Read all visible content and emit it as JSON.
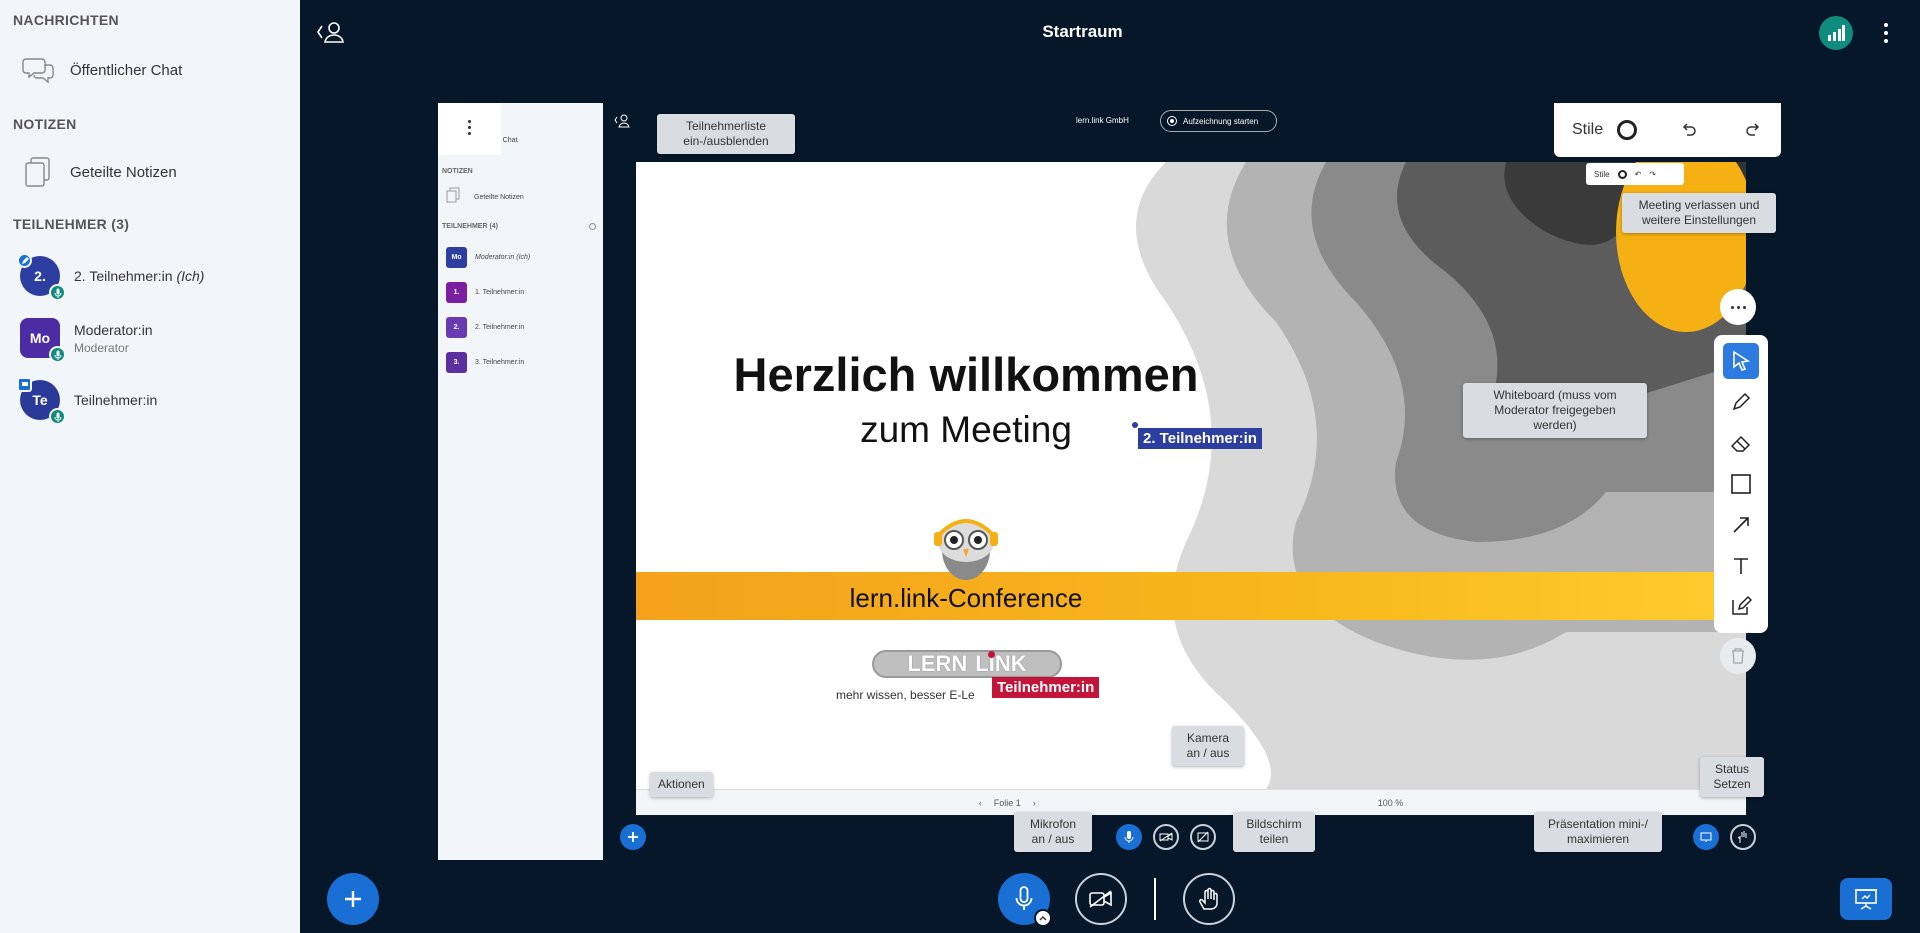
{
  "sidebar": {
    "messages_header": "NACHRICHTEN",
    "public_chat": "Öffentlicher Chat",
    "notes_header": "NOTIZEN",
    "shared_notes": "Geteilte Notizen",
    "participants_header": "TEILNEHMER (3)",
    "users": [
      {
        "initials": "2.",
        "name": "2. Teilnehmer:in",
        "self_tag": "(Ich)",
        "role": "",
        "color": "#2c3e9f"
      },
      {
        "initials": "Mo",
        "name": "Moderator:in",
        "self_tag": "",
        "role": "Moderator",
        "color": "#4b2ca3"
      },
      {
        "initials": "Te",
        "name": "Teilnehmer:in",
        "self_tag": "",
        "role": "",
        "color": "#2b3999"
      }
    ]
  },
  "header": {
    "room_title": "Startraum"
  },
  "mini_sidebar": {
    "chat": "licher Chat",
    "notes_header": "NOTIZEN",
    "notes": "Geteilte Notizen",
    "participants_header": "TEILNEHMER (4)",
    "users": [
      {
        "initials": "Mo",
        "name": "Moderator:in (Ich)",
        "color": "#2c3e9f"
      },
      {
        "initials": "1.",
        "name": "1. Teilnehmer:in",
        "color": "#7a1fa2"
      },
      {
        "initials": "2.",
        "name": "2. Teilnehmer:in",
        "color": "#6a3ab2"
      },
      {
        "initials": "3.",
        "name": "3. Teilnehmer:in",
        "color": "#5b2fa0"
      }
    ]
  },
  "mini_header": {
    "company": "lern.link GmbH",
    "record": "Aufzeichnung starten"
  },
  "slide": {
    "title": "Herzlich willkommen",
    "subtitle": "zum Meeting",
    "conference": "lern.link-Conference",
    "logo_left": "LERN",
    "logo_right": "LINK",
    "logo_tagline": "mehr wissen, besser E-Le",
    "cursor_1": "2. Teilnehmer:in",
    "cursor_2": "Teilnehmer:in",
    "slide_label": "Folie 1",
    "zoom": "100 %"
  },
  "whiteboard": {
    "styles_label": "Stile",
    "mini_styles_label": "Stile"
  },
  "tooltips": {
    "toggle_users": "Teilnehmerliste ein-/ausblenden",
    "leave_meeting": "Meeting verlassen und weitere Einstellungen",
    "whiteboard": "Whiteboard (muss vom Moderator freigegeben werden)",
    "actions": "Aktionen",
    "camera": "Kamera an / aus",
    "mic": "Mikrofon an / aus",
    "screen_share": "Bildschirm teilen",
    "status": "Status Setzen",
    "presentation": "Präsentation mini-/ maximieren"
  },
  "colors": {
    "background": "#06172a",
    "accent": "#1a6fd4",
    "teal": "#0f8b7f",
    "cursor_blue": "#2c3e9f",
    "cursor_red": "#c3143a"
  }
}
